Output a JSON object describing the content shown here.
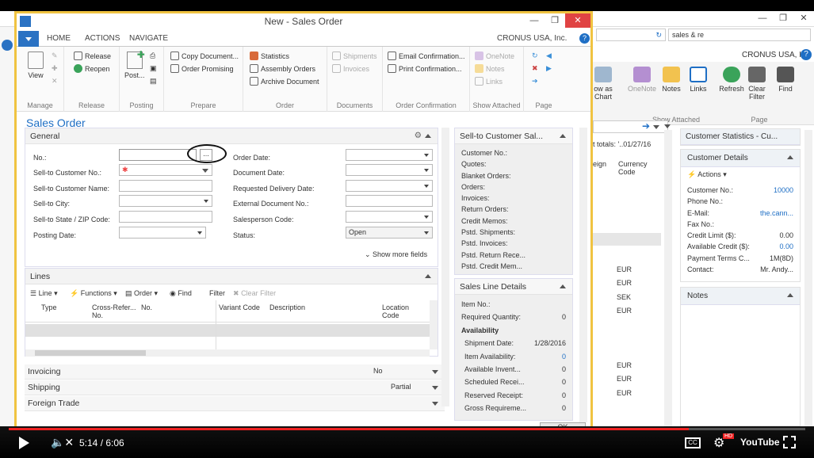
{
  "dialog": {
    "title": "New - Sales Order",
    "company": "CRONUS USA, Inc."
  },
  "tabs": [
    "HOME",
    "ACTIONS",
    "NAVIGATE"
  ],
  "ribbon": {
    "groups": [
      "Manage",
      "Release",
      "Posting",
      "Prepare",
      "Order",
      "Documents",
      "Order Confirmation",
      "Show Attached",
      "Page"
    ],
    "view": "View",
    "release": "Release",
    "reopen": "Reopen",
    "post": "Post...",
    "copy_document": "Copy Document...",
    "order_promising": "Order Promising",
    "statistics": "Statistics",
    "assembly_orders": "Assembly Orders",
    "archive_document": "Archive Document",
    "shipments": "Shipments",
    "invoices": "Invoices",
    "email_confirmation": "Email Confirmation...",
    "print_confirmation": "Print Confirmation...",
    "onenote": "OneNote",
    "notes": "Notes",
    "links": "Links"
  },
  "page_title": "Sales Order",
  "general": {
    "header": "General",
    "labels": [
      "No.:",
      "Sell-to Customer No.:",
      "Sell-to Customer Name:",
      "Sell-to City:",
      "Sell-to State / ZIP Code:",
      "Posting Date:"
    ],
    "right_labels": [
      "Order Date:",
      "Document Date:",
      "Requested Delivery Date:",
      "External Document No.:",
      "Salesperson Code:",
      "Status:"
    ],
    "status_value": "Open",
    "assist": "...",
    "show_more": "Show more fields"
  },
  "lines": {
    "header": "Lines",
    "toolbar": [
      "Line",
      "Functions",
      "Order",
      "Find",
      "Filter",
      "Clear Filter"
    ],
    "columns": [
      "Type",
      "Cross-Refer... No.",
      "No.",
      "Variant Code",
      "Description",
      "Location Code"
    ]
  },
  "collapsed": [
    {
      "label": "Invoicing",
      "value": "No"
    },
    {
      "label": "Shipping",
      "value": "Partial"
    },
    {
      "label": "Foreign Trade",
      "value": ""
    }
  ],
  "factbox_customer": {
    "header": "Sell-to Customer Sal...",
    "items": [
      "Customer No.:",
      "Quotes:",
      "Blanket Orders:",
      "Orders:",
      "Invoices:",
      "Return Orders:",
      "Credit Memos:",
      "Pstd. Shipments:",
      "Pstd. Invoices:",
      "Pstd. Return Rece...",
      "Pstd. Credit Mem..."
    ]
  },
  "factbox_line": {
    "header": "Sales Line Details",
    "items": [
      {
        "label": "Item No.:",
        "value": ""
      },
      {
        "label": "Required Quantity:",
        "value": "0"
      },
      {
        "label": "Availability",
        "value": ""
      },
      {
        "label": "Shipment Date:",
        "value": "1/28/2016"
      },
      {
        "label": "Item Availability:",
        "value": "0"
      },
      {
        "label": "Available Invent...",
        "value": "0"
      },
      {
        "label": "Scheduled Recei...",
        "value": "0"
      },
      {
        "label": "Reserved Receipt:",
        "value": "0"
      },
      {
        "label": "Gross Requireme...",
        "value": "0"
      }
    ]
  },
  "ok_button": "OK",
  "background": {
    "company": "CRONUS USA, Inc.",
    "search": "sales & re",
    "ribbon": [
      "OneNote",
      "Notes",
      "Links",
      "Refresh",
      "Clear Filter",
      "Find"
    ],
    "ribbon_partial": "ow as Chart",
    "groups": [
      "Show Attached",
      "Page"
    ],
    "totals": "t totals: '..01/27/16",
    "grid_cols": [
      "eign",
      "Currency Code"
    ],
    "currencies": [
      "EUR",
      "EUR",
      "SEK",
      "EUR",
      "EUR",
      "EUR",
      "EUR"
    ],
    "stats_header": "Customer Statistics - Cu...",
    "details_header": "Customer Details",
    "actions": "Actions",
    "details": [
      {
        "label": "Customer No.:",
        "value": "10000"
      },
      {
        "label": "Phone No.:",
        "value": ""
      },
      {
        "label": "E-Mail:",
        "value": "the.cann..."
      },
      {
        "label": "Fax No.:",
        "value": ""
      },
      {
        "label": "Credit Limit ($):",
        "value": "0.00"
      },
      {
        "label": "Available Credit ($):",
        "value": "0.00"
      },
      {
        "label": "Payment Terms C...",
        "value": "1M(8D)"
      },
      {
        "label": "Contact:",
        "value": "Mr. Andy..."
      }
    ],
    "notes": "Notes"
  },
  "player": {
    "time": "5:14 / 6:06",
    "progress": 0.854,
    "youtube": "YouTube",
    "hd": "HD"
  }
}
